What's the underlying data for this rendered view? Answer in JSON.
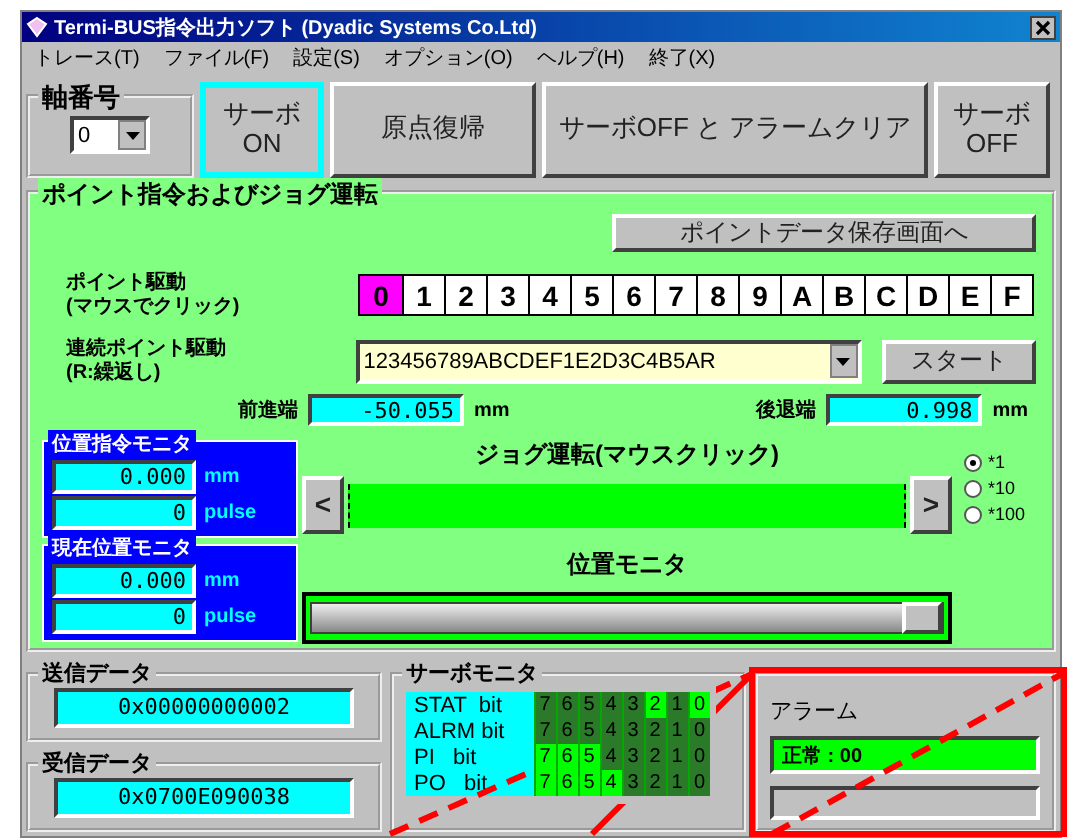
{
  "window": {
    "title": "Termi-BUS指令出力ソフト (Dyadic Systems Co.Ltd)"
  },
  "menu": [
    "トレース(T)",
    "ファイル(F)",
    "設定(S)",
    "オプション(O)",
    "ヘルプ(H)",
    "終了(X)"
  ],
  "axis": {
    "label": "軸番号",
    "value": "0"
  },
  "toolbar": [
    {
      "lines": [
        "サーボ",
        "ON"
      ],
      "selected": true
    },
    {
      "lines": [
        "原点復帰"
      ],
      "selected": false
    },
    {
      "lines": [
        "サーボOFF と アラームクリア"
      ],
      "selected": false
    },
    {
      "lines": [
        "サーボ",
        "OFF"
      ],
      "selected": false
    }
  ],
  "point_panel": {
    "title": "ポイント指令およびジョグ運転",
    "save_button": "ポイントデータ保存画面へ",
    "point_drive": {
      "lines": [
        "ポイント駆動",
        "(マウスでクリック)"
      ]
    },
    "points": [
      {
        "label": "0",
        "selected": true
      },
      {
        "label": "1",
        "selected": false
      },
      {
        "label": "2",
        "selected": false
      },
      {
        "label": "3",
        "selected": false
      },
      {
        "label": "4",
        "selected": false
      },
      {
        "label": "5",
        "selected": false
      },
      {
        "label": "6",
        "selected": false
      },
      {
        "label": "7",
        "selected": false
      },
      {
        "label": "8",
        "selected": false
      },
      {
        "label": "9",
        "selected": false
      },
      {
        "label": "A",
        "selected": false
      },
      {
        "label": "B",
        "selected": false
      },
      {
        "label": "C",
        "selected": false
      },
      {
        "label": "D",
        "selected": false
      },
      {
        "label": "E",
        "selected": false
      },
      {
        "label": "F",
        "selected": false
      }
    ],
    "continuous": {
      "lines": [
        "連続ポイント駆動",
        "(R:繰返し)"
      ],
      "value": "123456789ABCDEF1E2D3C4B5AR",
      "start_button": "スタート"
    },
    "limits": [
      {
        "label": "前進端",
        "value": "-50.055",
        "unit": "mm"
      },
      {
        "label": "後退端",
        "value": "0.998",
        "unit": "mm"
      }
    ],
    "monitors": [
      {
        "title": "位置指令モニタ",
        "rows": [
          {
            "value": "0.000",
            "unit": "mm"
          },
          {
            "value": "0",
            "unit": "pulse"
          }
        ]
      },
      {
        "title": "現在位置モニタ",
        "rows": [
          {
            "value": "0.000",
            "unit": "mm"
          },
          {
            "value": "0",
            "unit": "pulse"
          }
        ]
      }
    ],
    "jog": {
      "title": "ジョグ運転(マウスクリック)",
      "left": "<",
      "right": ">"
    },
    "scales": [
      {
        "label": "*1",
        "selected": true
      },
      {
        "label": "*10",
        "selected": false
      },
      {
        "label": "*100",
        "selected": false
      }
    ],
    "position": {
      "title": "位置モニタ",
      "level": 1
    }
  },
  "send_data": {
    "title": "送信データ",
    "value": "0x00000000002"
  },
  "receive_data": {
    "title": "受信データ",
    "value": "0x0700E090038"
  },
  "servo_monitor": {
    "title": "サーボモニタ",
    "rows": [
      {
        "label": "STAT  bit",
        "bits": [
          {
            "label": "7",
            "on": false
          },
          {
            "label": "6",
            "on": false
          },
          {
            "label": "5",
            "on": false
          },
          {
            "label": "4",
            "on": false
          },
          {
            "label": "3",
            "on": false
          },
          {
            "label": "2",
            "on": true
          },
          {
            "label": "1",
            "on": false
          },
          {
            "label": "0",
            "on": true
          }
        ]
      },
      {
        "label": "ALRM bit",
        "bits": [
          {
            "label": "7",
            "on": false
          },
          {
            "label": "6",
            "on": false
          },
          {
            "label": "5",
            "on": false
          },
          {
            "label": "4",
            "on": false
          },
          {
            "label": "3",
            "on": false
          },
          {
            "label": "2",
            "on": false
          },
          {
            "label": "1",
            "on": false
          },
          {
            "label": "0",
            "on": false
          }
        ]
      },
      {
        "label": "PI   bit",
        "bits": [
          {
            "label": "7",
            "on": true
          },
          {
            "label": "6",
            "on": true
          },
          {
            "label": "5",
            "on": true
          },
          {
            "label": "4",
            "on": false
          },
          {
            "label": "3",
            "on": false
          },
          {
            "label": "2",
            "on": false
          },
          {
            "label": "1",
            "on": false
          },
          {
            "label": "0",
            "on": false
          }
        ]
      },
      {
        "label": "PO   bit",
        "bits": [
          {
            "label": "7",
            "on": true
          },
          {
            "label": "6",
            "on": true
          },
          {
            "label": "5",
            "on": true
          },
          {
            "label": "4",
            "on": true
          },
          {
            "label": "3",
            "on": false
          },
          {
            "label": "2",
            "on": false
          },
          {
            "label": "1",
            "on": false
          },
          {
            "label": "0",
            "on": false
          }
        ]
      }
    ]
  },
  "alarm": {
    "title": "アラーム",
    "status": "正常 : 00"
  }
}
